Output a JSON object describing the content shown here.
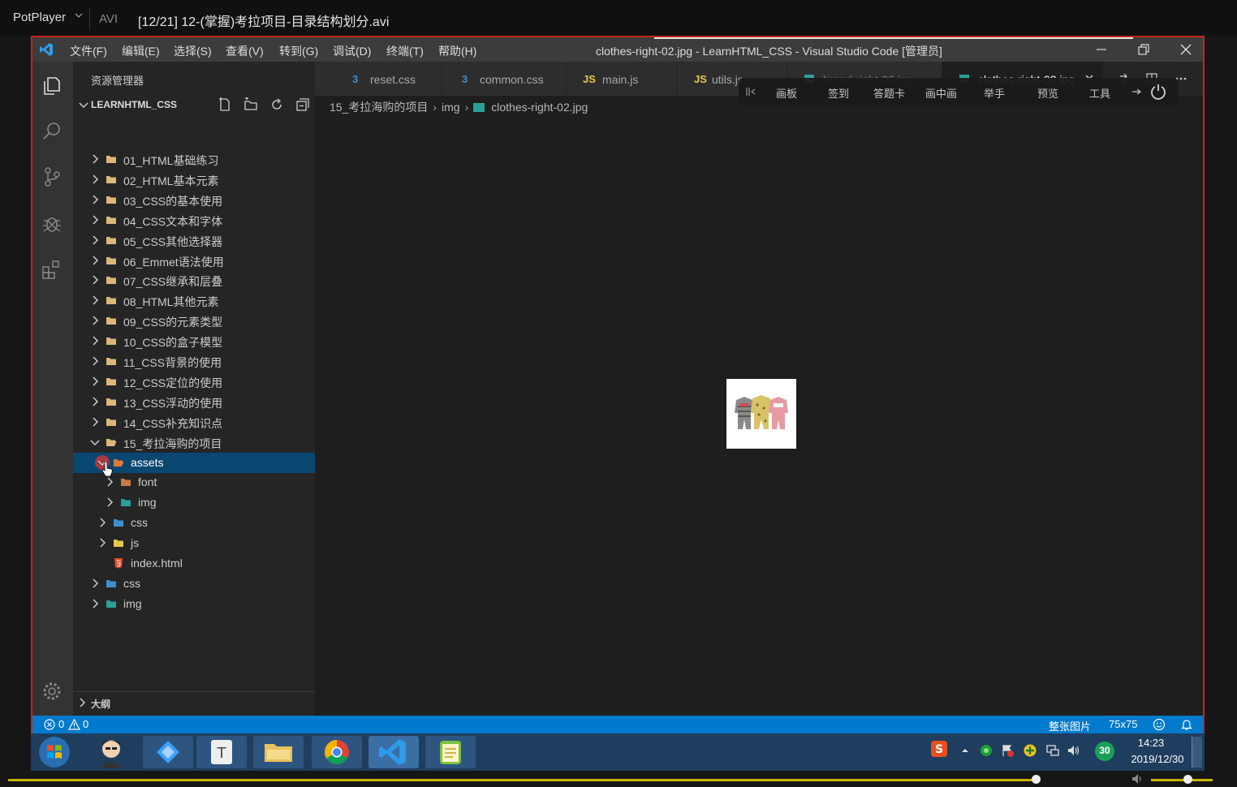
{
  "player": {
    "app_name": "PotPlayer",
    "format": "AVI",
    "title": "[12/21] 12-(掌握)考拉项目-目录结构划分.avi"
  },
  "vscode": {
    "menu": [
      "文件(F)",
      "编辑(E)",
      "选择(S)",
      "查看(V)",
      "转到(G)",
      "调试(D)",
      "终端(T)",
      "帮助(H)"
    ],
    "window_title": "clothes-right-02.jpg - LearnHTML_CSS - Visual Studio Code [管理员]",
    "sidebar": {
      "title": "资源管理器",
      "workspace": "LEARNHTML_CSS",
      "tree": [
        {
          "label": "01_HTML基础练习",
          "type": "folder",
          "expanded": false
        },
        {
          "label": "02_HTML基本元素",
          "type": "folder",
          "expanded": false
        },
        {
          "label": "03_CSS的基本使用",
          "type": "folder",
          "expanded": false
        },
        {
          "label": "04_CSS文本和字体",
          "type": "folder",
          "expanded": false
        },
        {
          "label": "05_CSS其他选择器",
          "type": "folder",
          "expanded": false
        },
        {
          "label": "06_Emmet语法使用",
          "type": "folder",
          "expanded": false
        },
        {
          "label": "07_CSS继承和层叠",
          "type": "folder",
          "expanded": false
        },
        {
          "label": "08_HTML其他元素",
          "type": "folder",
          "expanded": false
        },
        {
          "label": "09_CSS的元素类型",
          "type": "folder",
          "expanded": false
        },
        {
          "label": "10_CSS的盒子模型",
          "type": "folder",
          "expanded": false
        },
        {
          "label": "11_CSS背景的使用",
          "type": "folder",
          "expanded": false
        },
        {
          "label": "12_CSS定位的使用",
          "type": "folder",
          "expanded": false
        },
        {
          "label": "13_CSS浮动的使用",
          "type": "folder",
          "expanded": false
        },
        {
          "label": "14_CSS补充知识点",
          "type": "folder",
          "expanded": false
        },
        {
          "label": "15_考拉海购的项目",
          "type": "folder",
          "expanded": true
        },
        {
          "label": "assets",
          "type": "folder",
          "expanded": true,
          "selected": true
        },
        {
          "label": "font",
          "type": "folder",
          "expanded": false
        },
        {
          "label": "img",
          "type": "folder",
          "expanded": false
        },
        {
          "label": "css",
          "type": "folder",
          "expanded": false
        },
        {
          "label": "js",
          "type": "folder",
          "expanded": false
        },
        {
          "label": "index.html",
          "type": "file"
        },
        {
          "label": "css",
          "type": "folder",
          "expanded": false
        },
        {
          "label": "img",
          "type": "folder",
          "expanded": false
        }
      ],
      "outline_label": "大纲"
    },
    "tabs": [
      {
        "label": "reset.css",
        "icon": "3"
      },
      {
        "label": "common.css",
        "icon": "3"
      },
      {
        "label": "main.js",
        "icon": "JS"
      },
      {
        "label": "utils.js",
        "icon": "JS"
      },
      {
        "label": "brand-right-06.jpg",
        "icon": "img"
      },
      {
        "label": "clothes-right-02.jpg",
        "icon": "img",
        "active": true
      }
    ],
    "breadcrumb": [
      "15_考拉海购的项目",
      "img",
      "clothes-right-02.jpg"
    ],
    "floating_toolbar": [
      "画板",
      "签到",
      "答题卡",
      "画中画",
      "举手",
      "预览",
      "工具"
    ],
    "status": {
      "errors": "0",
      "warnings": "0",
      "image_mode": "整张图片",
      "image_size": "75x75"
    }
  },
  "taskbar": {
    "time": "14:23",
    "date": "2019/12/30",
    "badge": "30"
  },
  "colors": {
    "accent": "#007acc",
    "selection": "#094771",
    "window_border": "#c8241f",
    "seek": "#c8b400"
  },
  "player_progress": 0.9
}
